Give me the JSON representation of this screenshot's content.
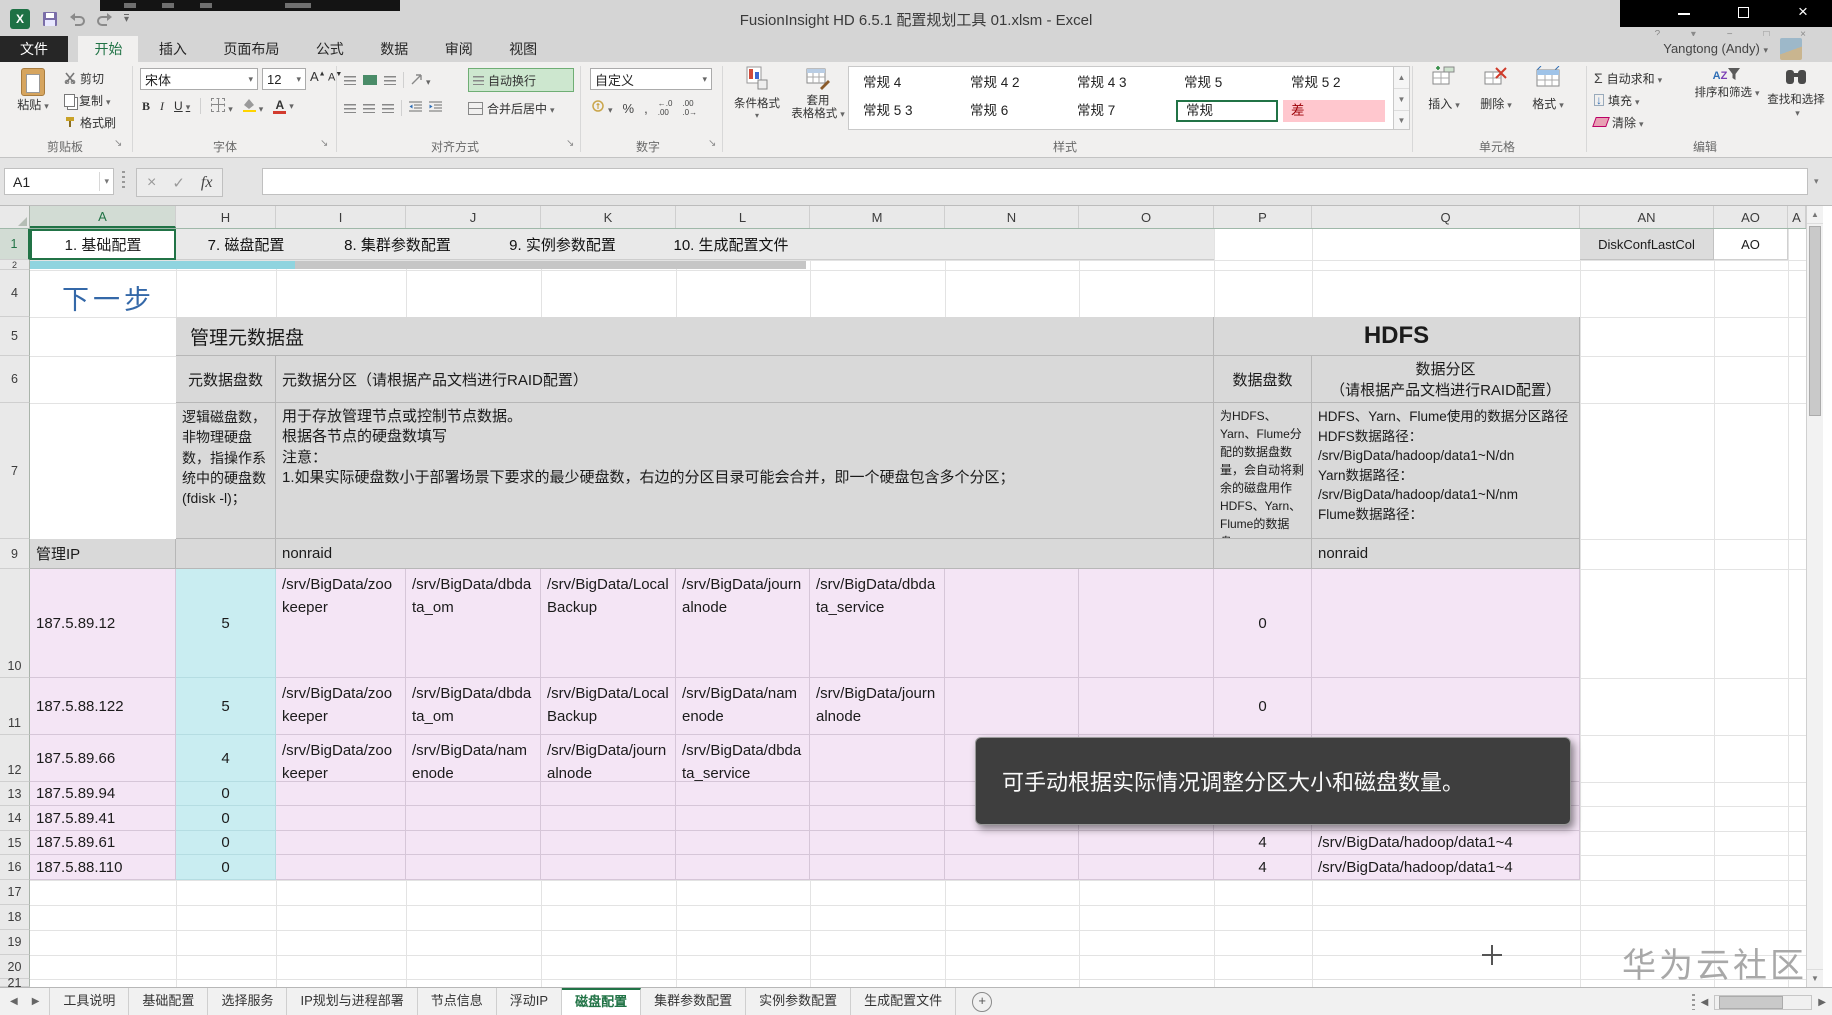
{
  "window": {
    "title": "FusionInsight HD 6.5.1 配置规划工具 01.xlsm - Excel",
    "user": "Yangtong (Andy)"
  },
  "ribbon_tabs": [
    "文件",
    "开始",
    "插入",
    "页面布局",
    "公式",
    "数据",
    "审阅",
    "视图"
  ],
  "ribbon": {
    "clipboard": {
      "group": "剪贴板",
      "paste": "粘贴",
      "cut": "剪切",
      "copy": "复制",
      "painter": "格式刷"
    },
    "font": {
      "group": "字体",
      "name": "宋体",
      "size": "12",
      "b": "B",
      "i": "I",
      "u": "U",
      "grow": "A",
      "shrink": "A",
      "color_a": "A"
    },
    "align": {
      "group": "对齐方式",
      "wrap": "自动换行",
      "merge": "合并后居中"
    },
    "number": {
      "group": "数字",
      "format": "自定义",
      "percent": "%",
      "comma": ","
    },
    "styles": {
      "group": "样式",
      "conditional": "条件格式",
      "table1": "套用",
      "table2": "表格格式",
      "gallery": [
        "常规 4",
        "常规 4 2",
        "常规 4 3",
        "常规 5",
        "常规 5 2",
        "常规 5 3",
        "常规 6",
        "常规 7",
        "常规",
        "差"
      ]
    },
    "cells": {
      "group": "单元格",
      "insert": "插入",
      "del": "删除",
      "format": "格式"
    },
    "edit": {
      "group": "编辑",
      "autosum": "自动求和",
      "sigma": "Σ",
      "fill": "填充",
      "clear": "清除",
      "sort": "排序和筛选",
      "find": "查找和选择"
    }
  },
  "formula": {
    "name_box": "A1",
    "fx": "fx"
  },
  "col_headers": [
    "A",
    "H",
    "I",
    "J",
    "K",
    "L",
    "M",
    "N",
    "O",
    "P",
    "Q",
    "AN",
    "AO",
    "A"
  ],
  "row_headers": [
    "1",
    "2",
    "4",
    "5",
    "6",
    "7",
    "9",
    "10",
    "11",
    "12",
    "13",
    "14",
    "15",
    "16",
    "17",
    "18",
    "19",
    "20",
    "21"
  ],
  "nav_row": {
    "base": "1. 基础配置",
    "disk": "7. 磁盘配置",
    "cluster": "8. 集群参数配置",
    "instance": "9. 实例参数配置",
    "generate": "10. 生成配置文件",
    "an": "DiskConfLastCol",
    "ao": "AO"
  },
  "next_btn": "下一步",
  "tbl": {
    "meta_title": "管理元数据盘",
    "hdfs_title": "HDFS",
    "meta_disks_h": "元数据盘数",
    "meta_part_h": "元数据分区（请根据产品文档进行RAID配置）",
    "hdfs_disks_h": "数据盘数",
    "hdfs_part_h": "数据分区\n（请根据产品文档进行RAID配置）",
    "meta_disks_desc": "逻辑磁盘数，非物理硬盘数，指操作系统中的硬盘数(fdisk -l)；",
    "meta_part_desc": "用于存放管理节点或控制节点数据。\n根据各节点的硬盘数填写\n注意：\n1.如果实际硬盘数小于部署场景下要求的最少硬盘数，右边的分区目录可能会合并，即一个硬盘包含多个分区；",
    "hdfs_disks_desc": "为HDFS、Yarn、Flume分配的数据盘数量，会自动将剩余的磁盘用作HDFS、Yarn、Flume的数据盘；",
    "hdfs_part_desc": "HDFS、Yarn、Flume使用的数据分区路径\nHDFS数据路径：\n/srv/BigData/hadoop/data1~N/dn\nYarn数据路径：\n/srv/BigData/hadoop/data1~N/nm\nFlume数据路径：",
    "mgmt_ip": "管理IP",
    "meta_raid": "nonraid",
    "hdfs_raid": "nonraid"
  },
  "rows": [
    {
      "ip": "187.5.89.12",
      "meta": "5",
      "parts": [
        "/srv/BigData/zookeeper",
        "/srv/BigData/dbdata_om",
        "/srv/BigData/LocalBackup",
        "/srv/BigData/journalnode",
        "/srv/BigData/dbdata_service"
      ],
      "hdfs_disks": "0",
      "hdfs_part": ""
    },
    {
      "ip": "187.5.88.122",
      "meta": "5",
      "parts": [
        "/srv/BigData/zookeeper",
        "/srv/BigData/dbdata_om",
        "/srv/BigData/LocalBackup",
        "/srv/BigData/namenode",
        "/srv/BigData/journalnode"
      ],
      "hdfs_disks": "0",
      "hdfs_part": ""
    },
    {
      "ip": "187.5.89.66",
      "meta": "4",
      "parts": [
        "/srv/BigData/zookeeper",
        "/srv/BigData/namenode",
        "/srv/BigData/journalnode",
        "/srv/BigData/dbdata_service"
      ],
      "hdfs_disks": "",
      "hdfs_part": ""
    },
    {
      "ip": "187.5.89.94",
      "meta": "0",
      "parts": [],
      "hdfs_disks": "",
      "hdfs_part": ""
    },
    {
      "ip": "187.5.89.41",
      "meta": "0",
      "parts": [],
      "hdfs_disks": "",
      "hdfs_part": ""
    },
    {
      "ip": "187.5.89.61",
      "meta": "0",
      "parts": [],
      "hdfs_disks": "4",
      "hdfs_part": "/srv/BigData/hadoop/data1~4"
    },
    {
      "ip": "187.5.88.110",
      "meta": "0",
      "parts": [],
      "hdfs_disks": "4",
      "hdfs_part": "/srv/BigData/hadoop/data1~4"
    }
  ],
  "tooltip": "可手动根据实际情况调整分区大小和磁盘数量。",
  "tabs": {
    "sheets": [
      "工具说明",
      "基础配置",
      "选择服务",
      "IP规划与进程部署",
      "节点信息",
      "浮动IP",
      "磁盘配置",
      "集群参数配置",
      "实例参数配置",
      "生成配置文件"
    ],
    "active": "磁盘配置"
  },
  "watermark": "华为云社区",
  "colors": {
    "accent_green": "#217346",
    "cell_pink": "#f4e5f5",
    "cell_cyan": "#c9edf1",
    "header_gray": "#d9d9d9",
    "bad_style": "#ffc7ce",
    "tooltip_bg": "#3e3e3e",
    "next_blue": "#3468a8"
  },
  "icons": {
    "dropdown": "▾",
    "close": "×",
    "check": "✓",
    "launcher": "↘",
    "sigma": "Σ",
    "fill_down": "↓",
    "scroll_up": "▲",
    "scroll_down": "▼",
    "tab_prev": "◀",
    "tab_next": "▶",
    "add_sheet": "+"
  }
}
